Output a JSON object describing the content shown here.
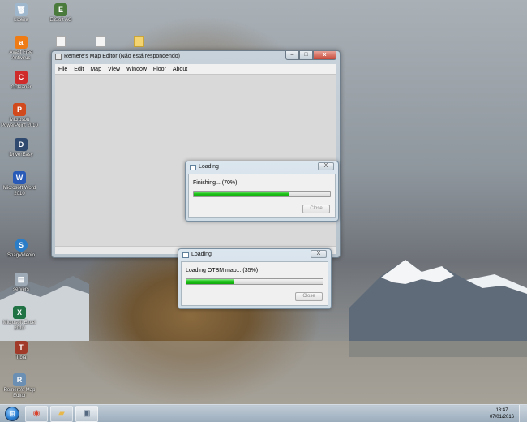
{
  "desktop": {
    "icons": [
      {
        "label": "Lixeira",
        "glyph": "🗑",
        "color": "#9fb7cc"
      },
      {
        "label": "EliSoft AG",
        "glyph": "E",
        "color": "#4a7a3c"
      },
      {
        "label": "Avast Free Antivirus",
        "glyph": "a",
        "color": "#ee7b14"
      },
      {
        "label": "CCleaner",
        "glyph": "C",
        "color": "#cf2b2b"
      },
      {
        "label": "Microsoft PowerPoint 2010",
        "glyph": "P",
        "color": "#d04a1e"
      },
      {
        "label": "DriverEasy",
        "glyph": "D",
        "color": "#2f4a6e"
      },
      {
        "label": "Microsoft Word 2010",
        "glyph": "W",
        "color": "#2a5ab8"
      },
      {
        "label": "SnagVideoio",
        "glyph": "S",
        "color": "#2b7dc8"
      },
      {
        "label": "servers",
        "glyph": "▤",
        "color": "#9eaab6"
      },
      {
        "label": "Microsoft Excel 2010",
        "glyph": "X",
        "color": "#217346"
      },
      {
        "label": "Tibia",
        "glyph": "T",
        "color": "#a23a2a"
      },
      {
        "label": "Remere's Map Editor",
        "glyph": "R",
        "color": "#6b8fb3"
      }
    ]
  },
  "main_window": {
    "title": "Remere's Map Editor (Não está respondendo)",
    "menus": [
      "File",
      "Edit",
      "Map",
      "View",
      "Window",
      "Floor",
      "About"
    ],
    "buttons": {
      "minimize": "–",
      "maximize": "□",
      "close": "x"
    }
  },
  "dialog1": {
    "title": "Loading",
    "message": "Finishing... (70%)",
    "progress": 0.7,
    "close_label": "Close",
    "x_label": "X"
  },
  "dialog2": {
    "title": "Loading",
    "message": "Loading OTBM map... (35%)",
    "progress": 0.35,
    "close_label": "Close",
    "x_label": "X"
  },
  "taskbar": {
    "start_glyph": "⊞",
    "items": [
      {
        "name": "chrome-icon",
        "glyph": "◉",
        "color": "#d9442f"
      },
      {
        "name": "folder-icon",
        "glyph": "▰",
        "color": "#e8b84a"
      },
      {
        "name": "map-editor-taskbar-icon",
        "glyph": "▣",
        "color": "#556a80"
      }
    ],
    "time": "18:47",
    "date": "07/01/2016"
  }
}
